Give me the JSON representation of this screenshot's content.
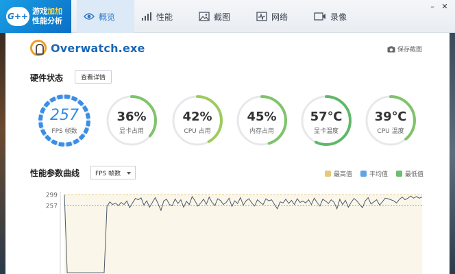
{
  "brand": {
    "logo": "G++",
    "line1_a": "游戏",
    "line1_b": "加加",
    "line2": "性能分析"
  },
  "nav": [
    {
      "label": "概览",
      "icon": "eye-icon",
      "active": true
    },
    {
      "label": "性能",
      "icon": "bar-chart-icon",
      "active": false
    },
    {
      "label": "截图",
      "icon": "image-icon",
      "active": false
    },
    {
      "label": "网络",
      "icon": "network-icon",
      "active": false
    },
    {
      "label": "录像",
      "icon": "video-icon",
      "active": false
    }
  ],
  "window_controls": {
    "minimize": "–",
    "close": "✕"
  },
  "game": {
    "name": "Overwatch.exe",
    "icon": "overwatch-logo"
  },
  "screenshot_button": "保存截图",
  "hardware": {
    "title": "硬件状态",
    "detail_button": "查看详情"
  },
  "gauges": [
    {
      "value": "257",
      "label": "FPS 帧数",
      "percent": 82,
      "color": "#3a8ee6",
      "style": "dashed"
    },
    {
      "value": "36%",
      "label": "显卡占用",
      "percent": 36,
      "color": "#7fc36b"
    },
    {
      "value": "42%",
      "label": "CPU 占用",
      "percent": 42,
      "color": "#9ccb5e"
    },
    {
      "value": "45%",
      "label": "内存占用",
      "percent": 45,
      "color": "#7fc36b"
    },
    {
      "value": "57℃",
      "label": "显卡温度",
      "percent": 57,
      "color": "#5fb86a"
    },
    {
      "value": "39℃",
      "label": "CPU 温度",
      "percent": 39,
      "color": "#7fc36b"
    }
  ],
  "curve": {
    "title": "性能参数曲线",
    "select_value": "FPS 帧数",
    "legend": [
      {
        "label": "最高值",
        "color": "#e8c77a"
      },
      {
        "label": "平均值",
        "color": "#5fa4e6"
      },
      {
        "label": "最低值",
        "color": "#6bbf6e"
      }
    ]
  },
  "chart_data": {
    "type": "line",
    "y_ticks": [
      "299",
      "257"
    ],
    "max_value": 299,
    "avg_value": 257,
    "ylim": [
      0,
      310
    ],
    "series": [
      {
        "values": [
          299,
          5,
          5,
          5,
          5,
          5,
          5,
          5,
          5,
          5,
          5,
          5,
          5,
          5,
          5,
          255,
          272,
          262,
          268,
          258,
          270,
          262,
          275,
          250,
          268,
          285,
          280,
          287,
          260,
          276,
          252,
          270,
          288,
          265,
          240,
          276,
          282,
          262,
          258,
          283,
          266,
          280,
          252,
          274,
          262,
          292,
          276,
          256,
          268,
          282,
          263,
          290,
          270,
          258,
          284,
          277,
          262,
          270,
          286,
          255,
          276,
          266,
          288,
          260,
          276,
          284,
          268,
          256,
          280,
          270,
          262,
          284,
          276,
          280,
          262,
          246,
          272,
          268,
          282,
          266,
          278,
          262,
          284,
          270,
          275,
          268,
          280,
          262,
          286,
          270,
          256,
          282,
          275,
          266,
          280,
          270,
          246,
          282,
          262,
          278,
          252,
          270,
          285,
          276,
          262,
          250,
          276,
          288,
          264,
          272,
          280,
          260,
          272,
          286,
          284,
          280,
          276,
          268,
          282,
          290,
          280,
          286,
          294,
          286,
          292,
          286,
          290
        ]
      }
    ]
  }
}
